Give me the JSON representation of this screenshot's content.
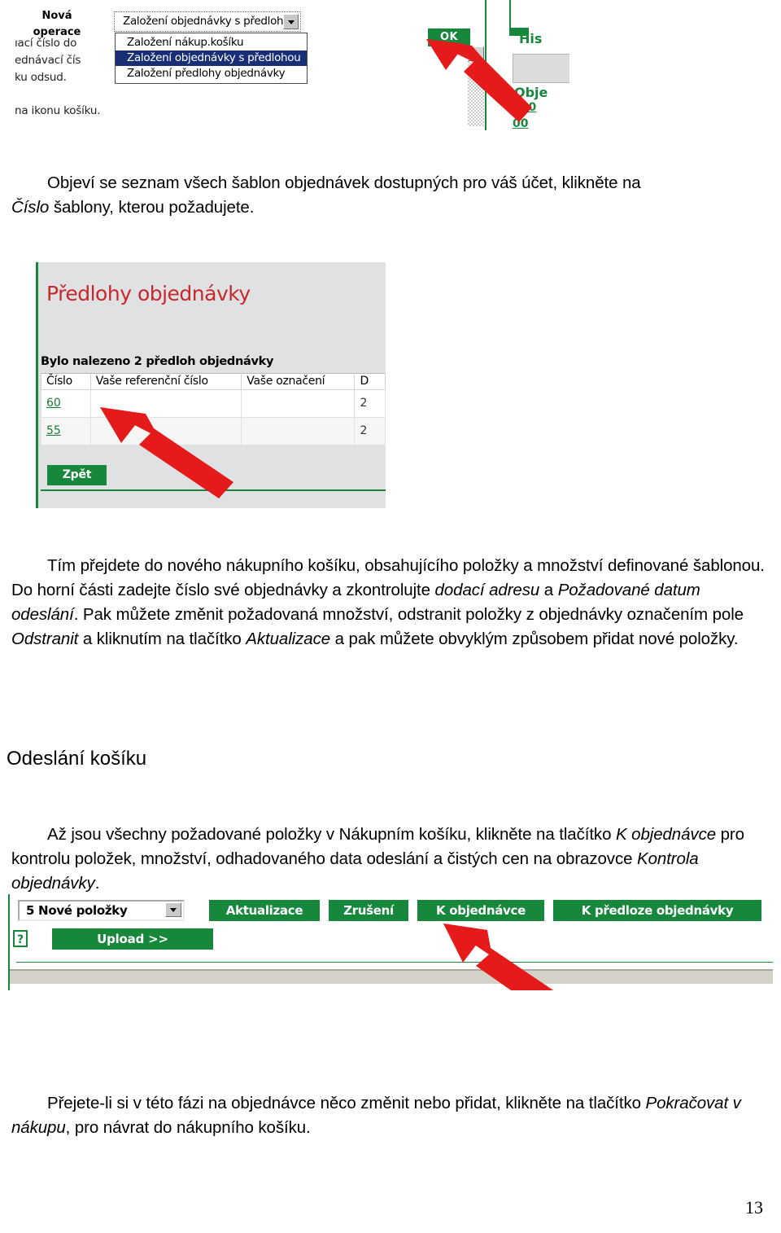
{
  "document": {
    "page_number": "13",
    "heading": "Odeslání košíku",
    "paragraphs": {
      "p1_line1": "Objeví se seznam všech šablon objednávek dostupných pro váš účet, klikněte na",
      "p1_line2_italic": "Číslo",
      "p1_line2_rest": " šablony, kterou požadujete.",
      "p2": {
        "seg1": "Tím přejdete do nového nákupního košíku, obsahujícího položky a množství definované šablonou. Do horní části zadejte číslo své objednávky a zkontrolujte ",
        "seg2_italic": "dodací adresu",
        "seg3": " a ",
        "seg4_italic": "Požadované datum odeslání",
        "seg5": ". Pak můžete změnit požadovaná množství, odstranit položky z objednávky označením pole ",
        "seg6_italic": "Odstranit",
        "seg7": " a kliknutím na tlačítko ",
        "seg8_italic": "Aktualizace",
        "seg9": " a pak můžete obvyklým způsobem přidat nové položky."
      },
      "p3": {
        "seg1": "Až jsou všechny požadované položky v Nákupním košíku, klikněte na tlačítko ",
        "seg2_italic": "K objednávce",
        "seg3": "  pro kontrolu položek, množství, odhadovaného data odeslání a čistých cen na obrazovce ",
        "seg4_italic": "Kontrola objednávky",
        "seg5": "."
      },
      "p4": {
        "seg1": "Přejete-li si v této fázi na objednávce něco změnit nebo přidat, klikněte na tlačítko ",
        "seg2_italic": "Pokračovat v nákupu",
        "seg3": ", pro návrat do nákupního košíku."
      }
    }
  },
  "screenshot_new_operation": {
    "label_line1": "Nová",
    "label_line2": "operace",
    "left_fragments": [
      "ıací číslo do",
      "ednávací čís",
      "ku odsud.",
      "na ikonu košíku."
    ],
    "select_value": "Založení objednávky s předlohou",
    "options": [
      "Založení nákup.košíku",
      "Založení objednávky s předlohou",
      "Založení předlohy objednávky"
    ],
    "selected_option_index": 1,
    "ok_button": "OK",
    "right_fragments": [
      "His",
      "Obje",
      "000",
      "00"
    ],
    "colors": {
      "green": "#17883b",
      "highlight": "#192f75"
    }
  },
  "screenshot_order_templates": {
    "title": "Předlohy objednávky",
    "found_text": "Bylo nalezeno 2 předloh objednávky",
    "columns": [
      "Číslo",
      "Vaše referenční číslo",
      "Vaše označení",
      "D"
    ],
    "rows": [
      {
        "cislo": "60",
        "reference": "",
        "oznaceni": "",
        "datum": "2"
      },
      {
        "cislo": "55",
        "reference": "",
        "oznaceni": "",
        "datum": "2"
      }
    ],
    "back_button": "Zpět",
    "colors": {
      "title_red": "#c8282c",
      "green": "#17883b",
      "panel_gray": "#dfe1e3"
    }
  },
  "screenshot_cart_toolbar": {
    "select_count": "5",
    "select_label": "Nové položky",
    "select_value": "5   Nové položky",
    "buttons": [
      "Aktualizace",
      "Zrušení",
      "K objednávce",
      "K předloze objednávky"
    ],
    "help_icon_label": "?",
    "upload_button": "Upload >>",
    "colors": {
      "green": "#17883b",
      "statusbar": "#d4d2c8"
    }
  }
}
